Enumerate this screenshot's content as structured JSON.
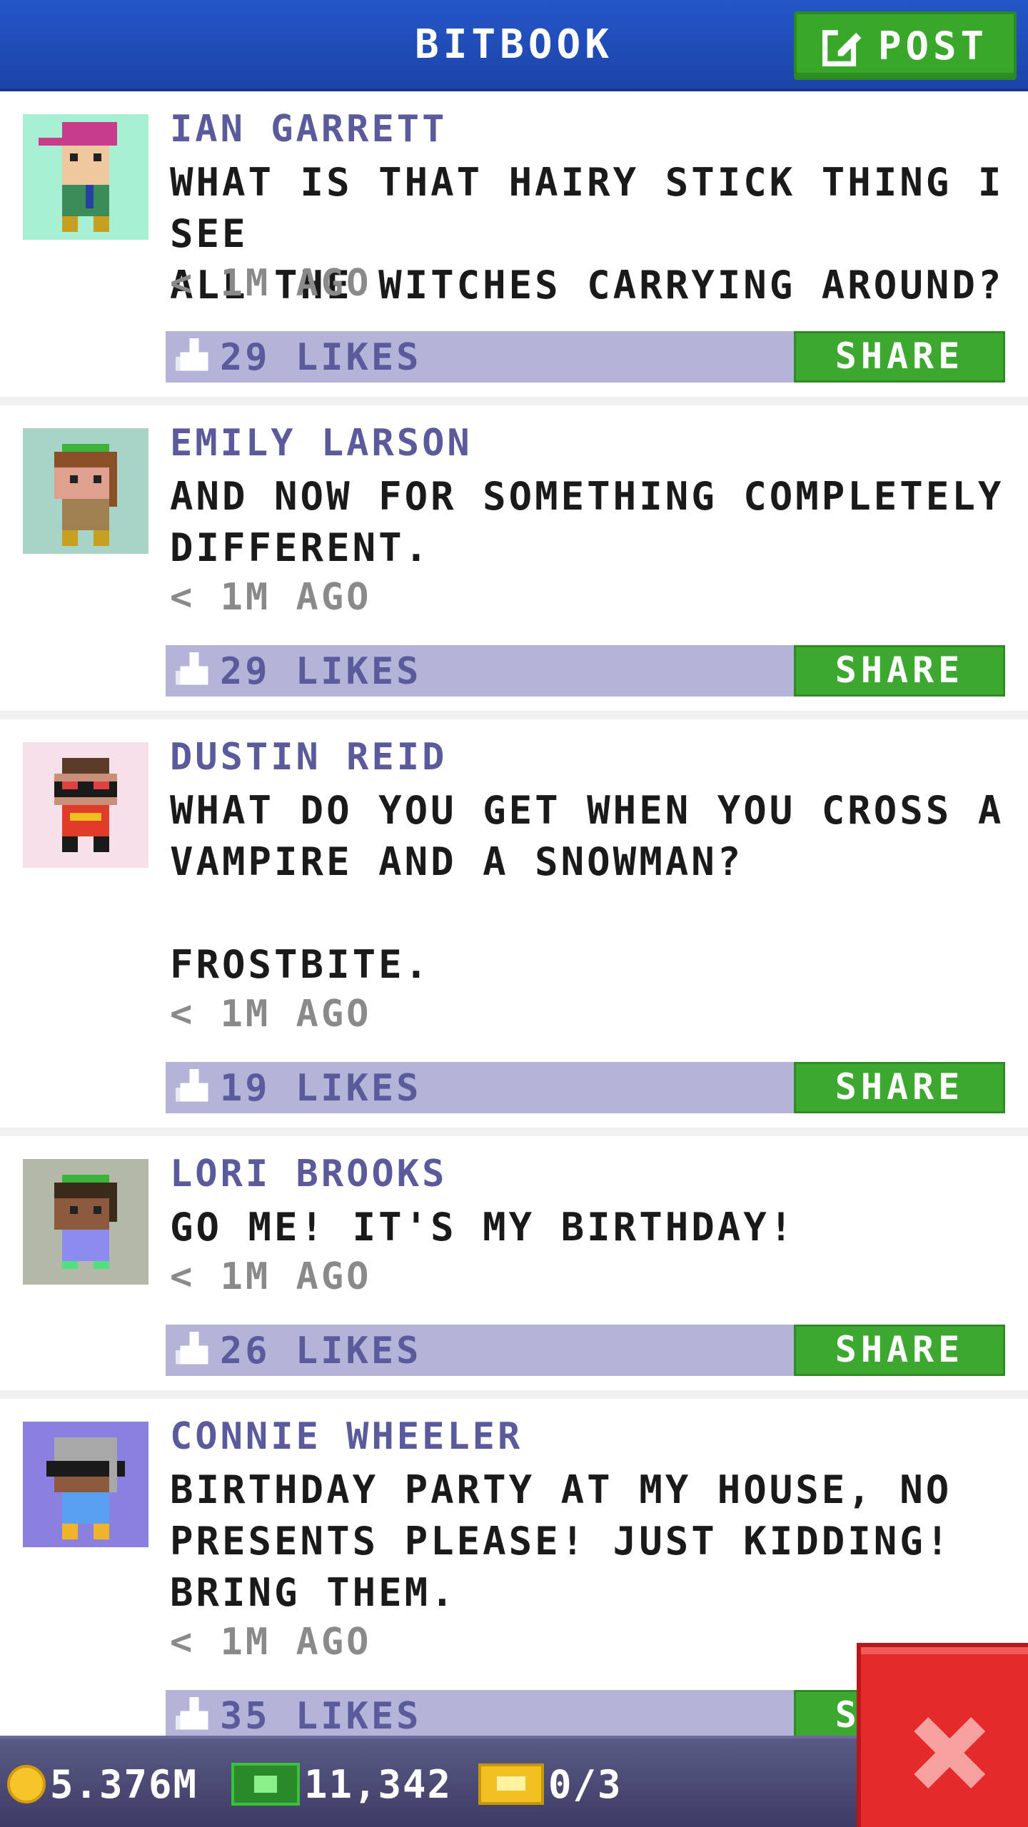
{
  "header": {
    "title": "BITBOOK",
    "post_label": "POST"
  },
  "posts": [
    {
      "author": "IAN GARRETT",
      "message": "WHAT IS THAT HAIRY STICK THING I SEE\nALL THE WITCHES CARRYING AROUND?",
      "time": "< 1M AGO",
      "likes": "29 LIKES",
      "share": "SHARE",
      "avatar_bg": "#a8f0d4"
    },
    {
      "author": "EMILY LARSON",
      "message": "AND NOW FOR SOMETHING COMPLETELY\nDIFFERENT.",
      "time": "< 1M AGO",
      "likes": "29 LIKES",
      "share": "SHARE",
      "avatar_bg": "#a8d4c8"
    },
    {
      "author": "DUSTIN REID",
      "message": "WHAT DO YOU GET WHEN YOU CROSS A\nVAMPIRE AND A SNOWMAN?\n\nFROSTBITE.",
      "time": "< 1M AGO",
      "likes": "19 LIKES",
      "share": "SHARE",
      "avatar_bg": "#f8e0ea"
    },
    {
      "author": "LORI BROOKS",
      "message": "GO ME! IT'S MY BIRTHDAY!",
      "time": "< 1M AGO",
      "likes": "26 LIKES",
      "share": "SHARE",
      "avatar_bg": "#b4b8a8"
    },
    {
      "author": "CONNIE WHEELER",
      "message": "BIRTHDAY PARTY AT MY HOUSE, NO\nPRESENTS PLEASE! JUST KIDDING!\nBRING THEM.",
      "time": "< 1M AGO",
      "likes": "35 LIKES",
      "share": "SHARE",
      "avatar_bg": "#8a80e0"
    }
  ],
  "footer": {
    "coins": "5.376M",
    "bux": "11,342",
    "tickets": "0/3"
  },
  "icons": {
    "post": "edit-icon",
    "like": "thumbs-up-icon",
    "coin": "coin-icon",
    "bux": "bux-icon",
    "ticket": "ticket-icon",
    "close": "close-icon"
  },
  "colors": {
    "header": "#2456c8",
    "green_button": "#3ca830",
    "like_bar": "#b4b4d8",
    "name_text": "#5a5a9c",
    "close_button": "#e42a2a"
  }
}
